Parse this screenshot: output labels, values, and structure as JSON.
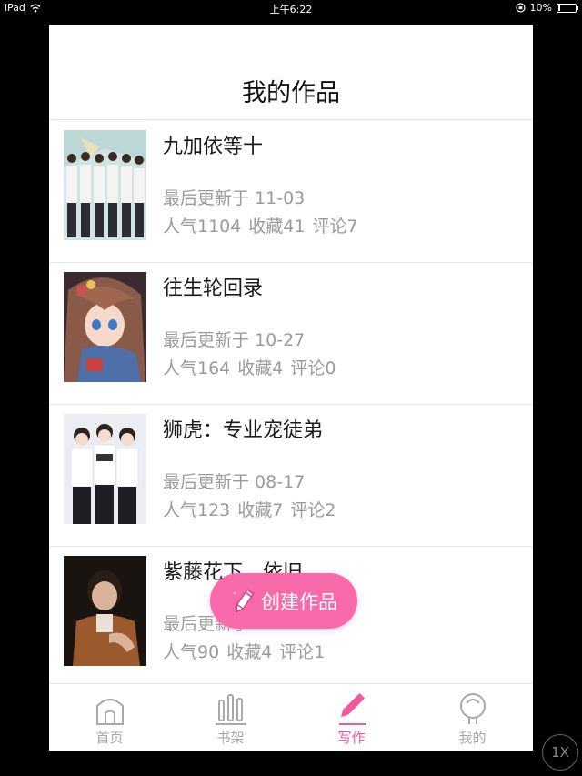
{
  "status_bar": {
    "device": "iPad",
    "time": "上午6:22",
    "battery": "10%",
    "battery_level": 0.1
  },
  "header": {
    "title": "我的作品"
  },
  "works": [
    {
      "title": "九加依等十",
      "updated": "最后更新于 11-03",
      "popularity": "人气1104",
      "favorites": "收藏41",
      "comments": "评论7"
    },
    {
      "title": "往生轮回录",
      "updated": "最后更新于 10-27",
      "popularity": "人气164",
      "favorites": "收藏4",
      "comments": "评论0"
    },
    {
      "title": "狮虎：专业宠徒弟",
      "updated": "最后更新于 08-17",
      "popularity": "人气123",
      "favorites": "收藏7",
      "comments": "评论2"
    },
    {
      "title": "紫藤花下，依旧",
      "updated": "最后更新于",
      "popularity": "人气90",
      "favorites": "收藏4",
      "comments": "评论1"
    }
  ],
  "create_button": {
    "label": "创建作品",
    "icon": "pencil-icon"
  },
  "tab_bar": {
    "active": "写作",
    "tabs": [
      {
        "label": "首页",
        "icon": "home-icon"
      },
      {
        "label": "书架",
        "icon": "bookshelf-icon"
      },
      {
        "label": "写作",
        "icon": "pencil-icon"
      },
      {
        "label": "我的",
        "icon": "profile-icon"
      }
    ]
  },
  "zoom_button": {
    "label": "1X"
  },
  "colors": {
    "accent": "#f05a9c",
    "fab": "#f86aaa",
    "secondary_text": "#9a9a9a",
    "inactive_tab": "#a9a9a9"
  }
}
